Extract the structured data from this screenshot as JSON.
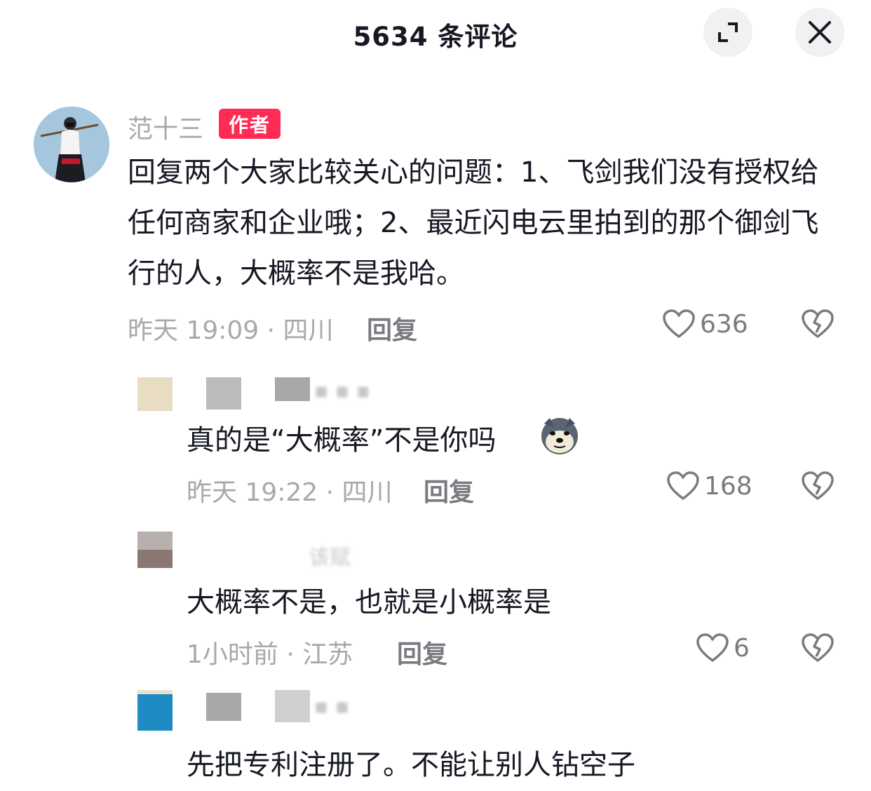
{
  "header": {
    "title": "5634 条评论"
  },
  "main_comment": {
    "username": "范十三",
    "badge": "作者",
    "text": "回复两个大家比较关心的问题：1、飞剑我们没有授权给任何商家和企业哦；2、最近闪电云里拍到的那个御剑飞行的人，大概率不是我哈。",
    "time_location": "昨天 19:09 · 四川",
    "reply_label": "回复",
    "likes": "636"
  },
  "replies": [
    {
      "text": "真的是“大概率”不是你吗",
      "time_location": "昨天 19:22 · 四川",
      "reply_label": "回复",
      "likes": "168",
      "blur_text": "▪ ▪ ▪"
    },
    {
      "text": "大概率不是，也就是小概率是",
      "time_location": "1小时前 · 江苏",
      "reply_label": "回复",
      "likes": "6",
      "blur_text": "该赋"
    },
    {
      "text": "先把专利注册了。不能让别人钻空子",
      "blur_text": "▪ ▪"
    }
  ],
  "colors": {
    "badge": "#fe2c55",
    "text": "#161823",
    "meta": "#a8a8ad",
    "button_bg": "#f1f1f2"
  }
}
